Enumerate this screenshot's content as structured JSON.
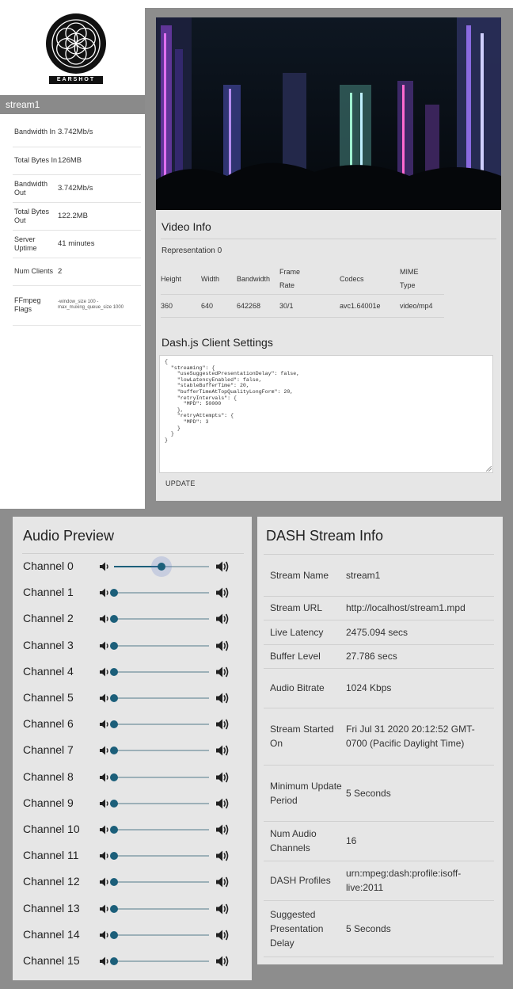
{
  "logo": {
    "icon": "flower-of-life-logo",
    "text": "EARSHOT"
  },
  "stream": {
    "name": "stream1",
    "stats": [
      {
        "label": "Bandwidth In",
        "value": "3.742Mb/s"
      },
      {
        "label": "Total Bytes In",
        "value": "126MB"
      },
      {
        "label": "Bandwidth Out",
        "value": "3.742Mb/s"
      },
      {
        "label": "Total Bytes Out",
        "value": "122.2MB"
      },
      {
        "label": "Server Uptime",
        "value": "41 minutes"
      },
      {
        "label": "Num Clients",
        "value": "2"
      },
      {
        "label": "FFmpeg Flags",
        "value": "-window_size 100 -max_muxing_queue_size 1000"
      }
    ]
  },
  "video_info": {
    "title": "Video Info",
    "representation": "Representation 0",
    "columns": [
      "Height",
      "Width",
      "Bandwidth",
      "Frame Rate",
      "Codecs",
      "MIME Type"
    ],
    "row": [
      "360",
      "640",
      "642268",
      "30/1",
      "avc1.64001e",
      "video/mp4"
    ]
  },
  "client_settings": {
    "title": "Dash.js Client Settings",
    "json_text": "{\n  \"streaming\": {\n    \"useSuggestedPresentationDelay\": false,\n    \"lowLatencyEnabled\": false,\n    \"stableBufferTime\": 20,\n    \"bufferTimeAtTopQualityLongForm\": 20,\n    \"retryIntervals\": {\n      \"MPD\": 50000\n    },\n    \"retryAttempts\": {\n      \"MPD\": 3\n    }\n  }\n}",
    "update_label": "UPDATE"
  },
  "audio_preview": {
    "title": "Audio Preview",
    "icons": {
      "low": "volume-low-icon",
      "high": "volume-high-icon"
    },
    "colors": {
      "thumb": "#1c5f7a",
      "track": "#9cb0b8"
    },
    "channels": [
      {
        "label": "Channel 0",
        "level": 0.5
      },
      {
        "label": "Channel 1",
        "level": 0
      },
      {
        "label": "Channel 2",
        "level": 0
      },
      {
        "label": "Channel 3",
        "level": 0
      },
      {
        "label": "Channel 4",
        "level": 0
      },
      {
        "label": "Channel 5",
        "level": 0
      },
      {
        "label": "Channel 6",
        "level": 0
      },
      {
        "label": "Channel 7",
        "level": 0
      },
      {
        "label": "Channel 8",
        "level": 0
      },
      {
        "label": "Channel 9",
        "level": 0
      },
      {
        "label": "Channel 10",
        "level": 0
      },
      {
        "label": "Channel 11",
        "level": 0
      },
      {
        "label": "Channel 12",
        "level": 0
      },
      {
        "label": "Channel 13",
        "level": 0
      },
      {
        "label": "Channel 14",
        "level": 0
      },
      {
        "label": "Channel 15",
        "level": 0
      }
    ]
  },
  "dash_info": {
    "title": "DASH Stream Info",
    "rows": [
      {
        "label": "Stream Name",
        "value": "stream1"
      },
      {
        "label": "Stream URL",
        "value": "http://localhost/stream1.mpd"
      },
      {
        "label": "Live Latency",
        "value": "2475.094 secs"
      },
      {
        "label": "Buffer Level",
        "value": "27.786 secs"
      },
      {
        "label": "Audio Bitrate",
        "value": "1024 Kbps"
      },
      {
        "label": "Stream Started On",
        "value": "Fri Jul 31 2020 20:12:52 GMT-0700 (Pacific Daylight Time)"
      },
      {
        "label": "Minimum Update Period",
        "value": "5 Seconds"
      },
      {
        "label": "Num Audio Channels",
        "value": "16"
      },
      {
        "label": "DASH Profiles",
        "value": "urn:mpeg:dash:profile:isoff-live:2011"
      },
      {
        "label": "Suggested Presentation Delay",
        "value": "5 Seconds"
      }
    ]
  }
}
